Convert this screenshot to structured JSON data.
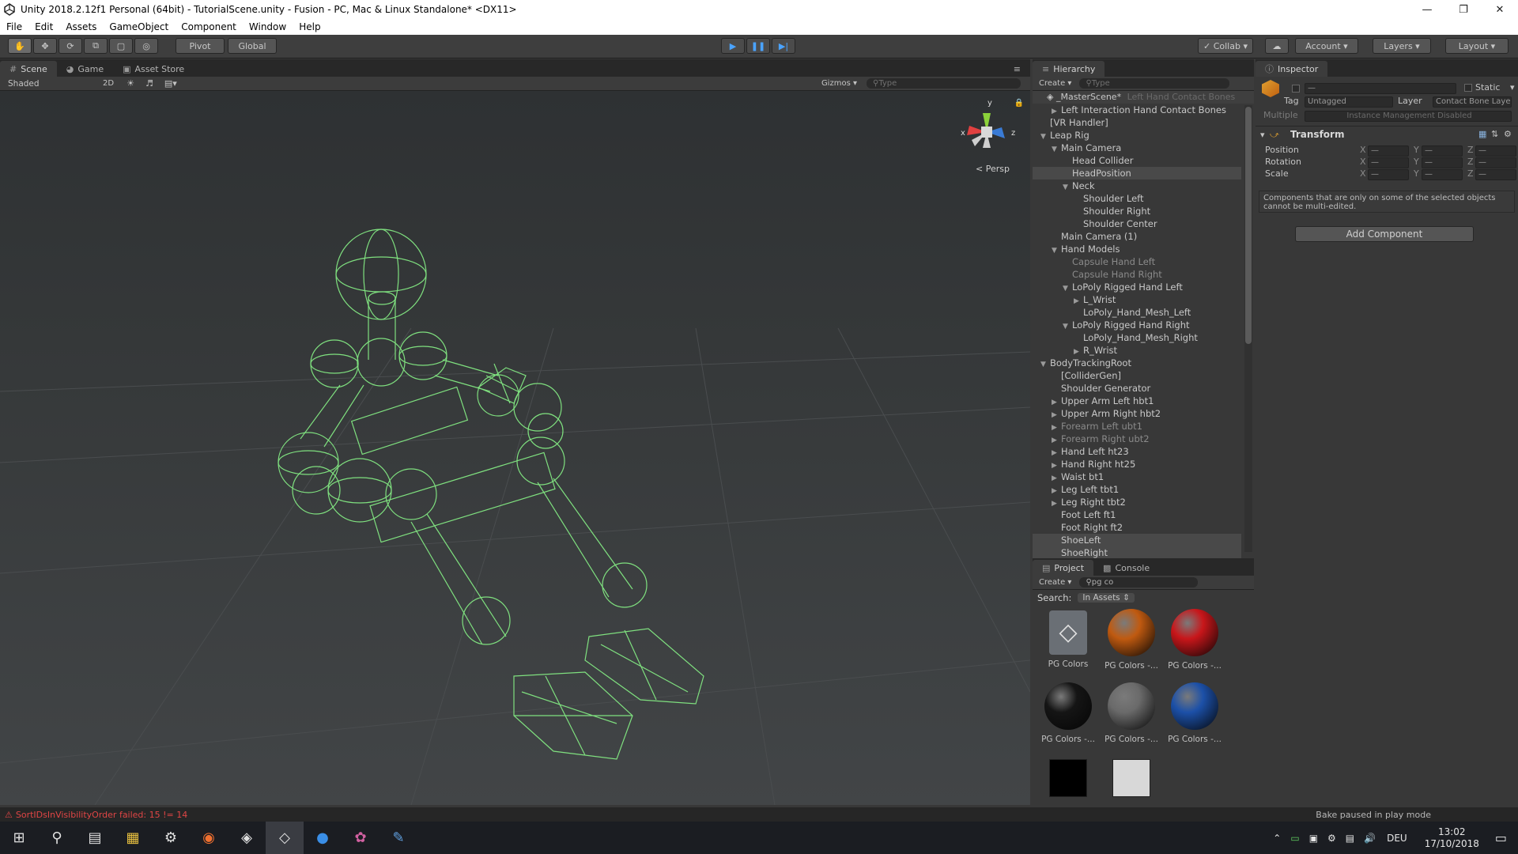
{
  "window": {
    "title": "Unity 2018.2.12f1 Personal (64bit) - TutorialScene.unity - Fusion - PC, Mac & Linux Standalone* <DX11>"
  },
  "menu": [
    "File",
    "Edit",
    "Assets",
    "GameObject",
    "Component",
    "Window",
    "Help"
  ],
  "toolbar": {
    "pivot": "Pivot",
    "global": "Global",
    "collab": "Collab",
    "account": "Account",
    "layers": "Layers",
    "layout": "Layout"
  },
  "scene": {
    "tabs": [
      "Scene",
      "Game",
      "Asset Store"
    ],
    "shading": "Shaded",
    "mode_2d": "2D",
    "gizmos": "Gizmos",
    "search_placeholder": "Type",
    "persp": "Persp",
    "axis_y": "y",
    "axis_x": "x",
    "axis_z": "z"
  },
  "hierarchy": {
    "tab": "Hierarchy",
    "create": "Create",
    "search_placeholder": "Type",
    "scene_name": "_MasterScene*",
    "scene_suffix": "Left Hand Contact Bones",
    "rows": [
      {
        "indent": 2,
        "label": "Left Interaction Hand Contact Bones",
        "arrow": "right"
      },
      {
        "indent": 1,
        "label": "[VR Handler]",
        "arrow": ""
      },
      {
        "indent": 1,
        "label": "Leap Rig",
        "arrow": "down"
      },
      {
        "indent": 2,
        "label": "Main Camera",
        "arrow": "down"
      },
      {
        "indent": 3,
        "label": "Head Collider",
        "arrow": ""
      },
      {
        "indent": 3,
        "label": "HeadPosition",
        "arrow": "",
        "sel": true
      },
      {
        "indent": 3,
        "label": "Neck",
        "arrow": "down"
      },
      {
        "indent": 4,
        "label": "Shoulder Left",
        "arrow": ""
      },
      {
        "indent": 4,
        "label": "Shoulder Right",
        "arrow": ""
      },
      {
        "indent": 4,
        "label": "Shoulder Center",
        "arrow": ""
      },
      {
        "indent": 2,
        "label": "Main Camera (1)",
        "arrow": ""
      },
      {
        "indent": 2,
        "label": "Hand Models",
        "arrow": "down"
      },
      {
        "indent": 3,
        "label": "Capsule Hand Left",
        "arrow": "",
        "dim": true
      },
      {
        "indent": 3,
        "label": "Capsule Hand Right",
        "arrow": "",
        "dim": true
      },
      {
        "indent": 3,
        "label": "LoPoly Rigged Hand Left",
        "arrow": "down"
      },
      {
        "indent": 4,
        "label": "L_Wrist",
        "arrow": "right"
      },
      {
        "indent": 4,
        "label": "LoPoly_Hand_Mesh_Left",
        "arrow": ""
      },
      {
        "indent": 3,
        "label": "LoPoly Rigged Hand Right",
        "arrow": "down"
      },
      {
        "indent": 4,
        "label": "LoPoly_Hand_Mesh_Right",
        "arrow": ""
      },
      {
        "indent": 4,
        "label": "R_Wrist",
        "arrow": "right"
      },
      {
        "indent": 1,
        "label": "BodyTrackingRoot",
        "arrow": "down"
      },
      {
        "indent": 2,
        "label": "[ColliderGen]",
        "arrow": ""
      },
      {
        "indent": 2,
        "label": "Shoulder Generator",
        "arrow": ""
      },
      {
        "indent": 2,
        "label": "Upper Arm Left hbt1",
        "arrow": "right"
      },
      {
        "indent": 2,
        "label": "Upper Arm Right hbt2",
        "arrow": "right"
      },
      {
        "indent": 2,
        "label": "Forearm Left ubt1",
        "arrow": "right",
        "dim": true
      },
      {
        "indent": 2,
        "label": "Forearm Right ubt2",
        "arrow": "right",
        "dim": true
      },
      {
        "indent": 2,
        "label": "Hand Left ht23",
        "arrow": "right"
      },
      {
        "indent": 2,
        "label": "Hand Right ht25",
        "arrow": "right"
      },
      {
        "indent": 2,
        "label": "Waist bt1",
        "arrow": "right"
      },
      {
        "indent": 2,
        "label": "Leg Left tbt1",
        "arrow": "right"
      },
      {
        "indent": 2,
        "label": "Leg Right tbt2",
        "arrow": "right"
      },
      {
        "indent": 2,
        "label": "Foot Left ft1",
        "arrow": ""
      },
      {
        "indent": 2,
        "label": "Foot Right ft2",
        "arrow": ""
      },
      {
        "indent": 2,
        "label": "ShoeLeft",
        "arrow": "",
        "sel": true
      },
      {
        "indent": 2,
        "label": "ShoeRight",
        "arrow": "",
        "sel": true
      }
    ]
  },
  "inspector": {
    "tab": "Inspector",
    "static": "Static",
    "tag_label": "Tag",
    "tag_value": "Untagged",
    "layer_label": "Layer",
    "layer_value": "Contact Bone Laye",
    "multiple": "Multiple",
    "instance": "Instance Management Disabled",
    "transform": "Transform",
    "position": "Position",
    "rotation": "Rotation",
    "scale": "Scale",
    "x": "X",
    "y": "Y",
    "z": "Z",
    "dash": "—",
    "note": "Components that are only on some of the selected objects cannot be multi-edited.",
    "add_component": "Add Component"
  },
  "project": {
    "tabs": [
      "Project",
      "Console"
    ],
    "create": "Create",
    "search_value": "pg co",
    "search_label": "Search:",
    "search_scope": "In Assets",
    "assets": [
      {
        "label": "PG Colors",
        "kind": "unity",
        "color": ""
      },
      {
        "label": "PG Colors -...",
        "kind": "sphere",
        "color": "#c05a10"
      },
      {
        "label": "PG Colors -...",
        "kind": "sphere",
        "color": "#c8161a"
      },
      {
        "label": "PG Colors -...",
        "kind": "sphere",
        "color": "#151515"
      },
      {
        "label": "PG Colors -...",
        "kind": "sphere",
        "color": "#6a6a6a"
      },
      {
        "label": "PG Colors -...",
        "kind": "sphere",
        "color": "#1c50a8"
      },
      {
        "label": "",
        "kind": "square",
        "color": "#000000"
      },
      {
        "label": "",
        "kind": "square",
        "color": "#d8d8d8"
      }
    ]
  },
  "status": {
    "error": "SortIDsInVisibilityOrder failed: 15 != 14",
    "bake": "Bake paused in play mode"
  },
  "taskbar": {
    "language": "DEU",
    "time": "13:02",
    "date": "17/10/2018"
  },
  "colors": {
    "wire": "#7fe07f",
    "accent": "#3a7bd5"
  }
}
